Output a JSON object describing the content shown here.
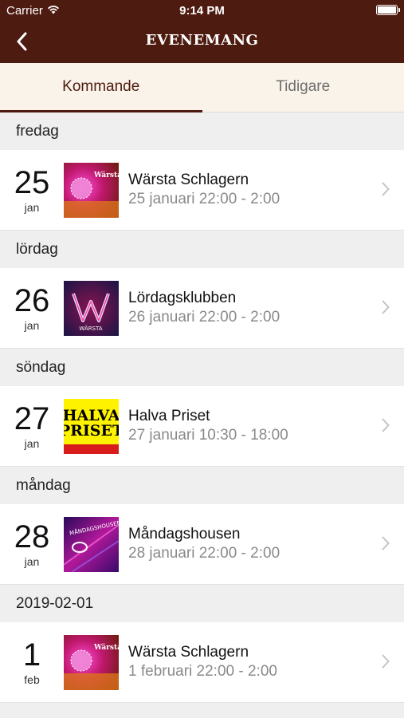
{
  "status": {
    "carrier": "Carrier",
    "time": "9:14 PM"
  },
  "nav": {
    "title": "EVENEMANG"
  },
  "tabs": [
    {
      "label": "Kommande",
      "active": true
    },
    {
      "label": "Tidigare",
      "active": false
    }
  ],
  "events": [
    {
      "section": "fredag",
      "day": "25",
      "month": "jan",
      "name": "Wärsta Schlagern",
      "time": "25 januari 22:00 - 2:00",
      "thumb_icon": "schlager-poster-icon"
    },
    {
      "section": "lördag",
      "day": "26",
      "month": "jan",
      "name": "Lördagsklubben",
      "time": "26 januari 22:00 - 2:00",
      "thumb_icon": "lordagsklubben-logo-icon"
    },
    {
      "section": "söndag",
      "day": "27",
      "month": "jan",
      "name": "Halva Priset",
      "time": "27 januari 10:30 - 18:00",
      "thumb_icon": "halva-priset-poster-icon"
    },
    {
      "section": "måndag",
      "day": "28",
      "month": "jan",
      "name": "Måndagshousen",
      "time": "28 januari 22:00 - 2:00",
      "thumb_icon": "mandagshousen-poster-icon"
    },
    {
      "section": "2019-02-01",
      "day": "1",
      "month": "feb",
      "name": "Wärsta Schlagern",
      "time": "1 februari 22:00 - 2:00",
      "thumb_icon": "schlager-poster-icon"
    }
  ],
  "thumb_texts": {
    "schlager": "Wärsta Schlager",
    "lordags": "WÄRSTA",
    "halva_1": "HALVA",
    "halva_2": "PRISET",
    "mandags": "MÅNDAGSHOUSEN"
  },
  "colors": {
    "header": "#4e1b10",
    "tab_bg": "#faf3e9",
    "accent": "#4e1b10"
  }
}
